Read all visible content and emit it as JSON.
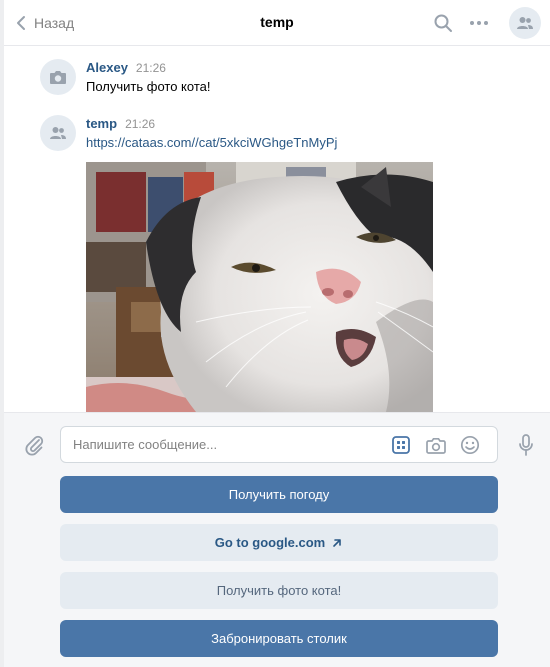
{
  "header": {
    "back_label": "Назад",
    "title": "temp"
  },
  "messages": [
    {
      "author": "Alexey",
      "time": "21:26",
      "text": "Получить фото кота!",
      "avatar_icon": "camera-icon"
    },
    {
      "author": "temp",
      "time": "21:26",
      "text": "https://cataas.com//cat/5xkciWGhgeTnMyPj",
      "avatar_icon": "group-icon"
    }
  ],
  "composer": {
    "placeholder": "Напишите сообщение..."
  },
  "keyboard": [
    {
      "label": "Получить погоду",
      "style": "primary"
    },
    {
      "label": "Go to google.com",
      "style": "link"
    },
    {
      "label": "Получить фото кота!",
      "style": "secondary"
    },
    {
      "label": "Забронировать столик",
      "style": "primary"
    }
  ],
  "colors": {
    "accent": "#4a76a8",
    "link": "#2a5885",
    "secondary_button": "#e5ebf1",
    "icon": "#99a2ad"
  }
}
